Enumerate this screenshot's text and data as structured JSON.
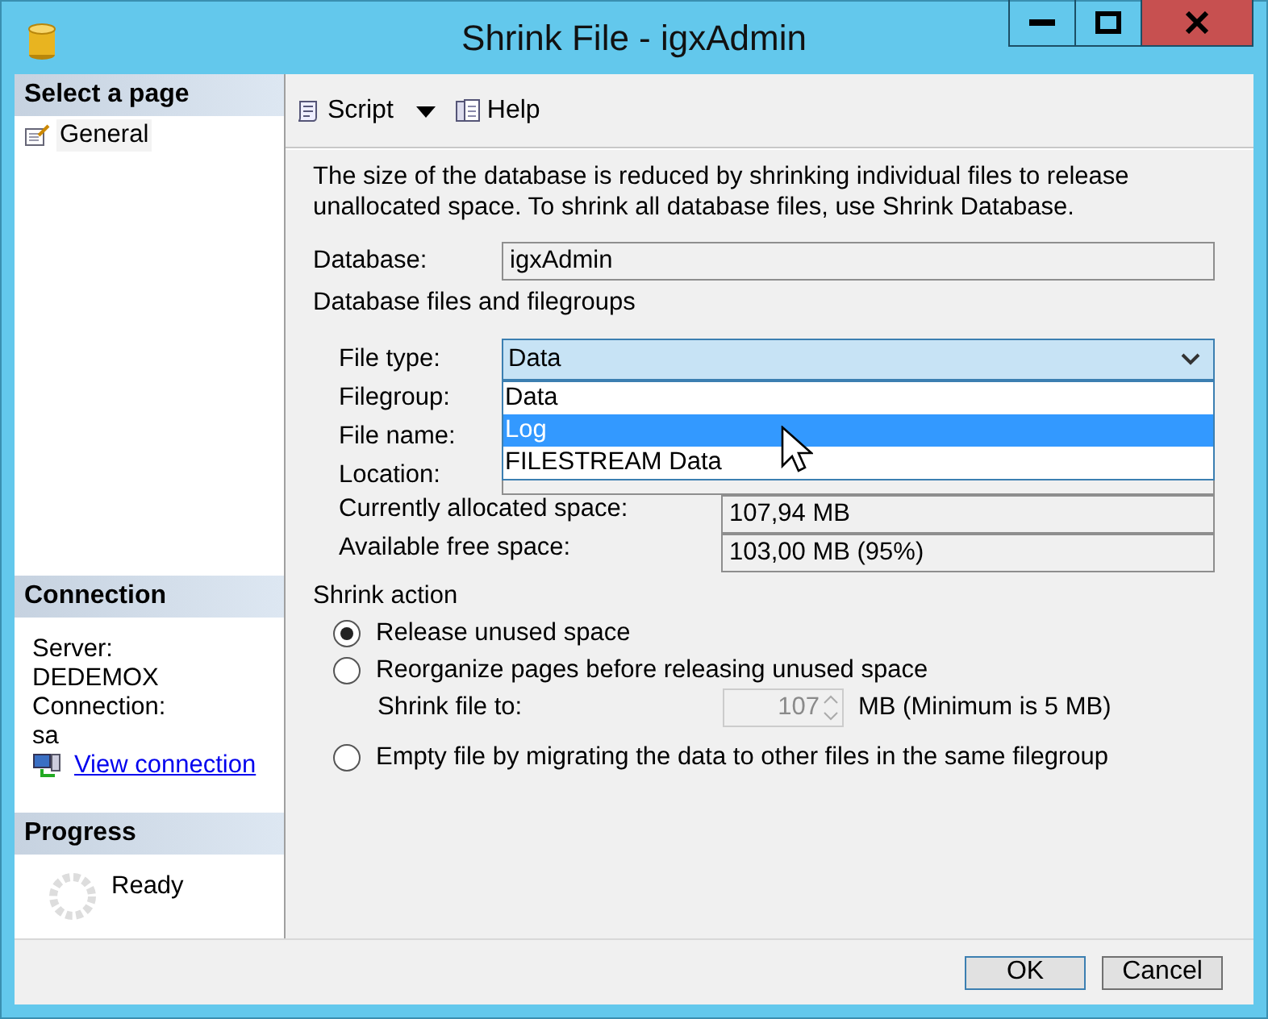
{
  "window": {
    "title": "Shrink File - igxAdmin"
  },
  "sidebar": {
    "select_page": {
      "heading": "Select a page",
      "items": [
        {
          "label": "General",
          "selected": true
        }
      ]
    },
    "connection": {
      "heading": "Connection",
      "server_label": "Server:",
      "server": "DEDEMOX",
      "connection_label": "Connection:",
      "connection": "sa",
      "link": "View connection"
    },
    "progress": {
      "heading": "Progress",
      "status": "Ready"
    }
  },
  "toolbar": [
    {
      "kind": "script",
      "label": "Script",
      "has_menu": true
    },
    {
      "kind": "help",
      "label": "Help",
      "has_menu": false
    }
  ],
  "description": "The size of the database is reduced by shrinking individual files to release unallocated space. To shrink all database files, use Shrink Database.",
  "database": {
    "label": "Database:",
    "value": "igxAdmin"
  },
  "files_section": {
    "heading": "Database files and filegroups",
    "file_type": {
      "label": "File type:",
      "value": "Data",
      "expanded": true,
      "options": [
        {
          "label": "Data",
          "highlighted": false
        },
        {
          "label": "Log",
          "highlighted": true
        },
        {
          "label": "FILESTREAM Data",
          "highlighted": false
        }
      ]
    },
    "filegroup_label": "Filegroup:",
    "file_name_label": "File name:",
    "location_label": "Location:",
    "allocated": {
      "label": "Currently allocated space:",
      "value": "107,94 MB"
    },
    "free": {
      "label": "Available free space:",
      "value": "103,00 MB (95%)"
    }
  },
  "shrink_action": {
    "heading": "Shrink action",
    "options": [
      {
        "label": "Release unused space",
        "selected": true
      },
      {
        "label": "Reorganize pages before releasing unused space",
        "selected": false
      },
      {
        "label": "Empty file by migrating the data to other files in the same filegroup",
        "selected": false
      }
    ],
    "shrink_to": {
      "label": "Shrink file to:",
      "value": "107",
      "unit": "MB (Minimum is 5 MB)",
      "disabled": true
    }
  },
  "buttons": [
    {
      "label": "OK",
      "default": true
    },
    {
      "label": "Cancel",
      "default": false
    }
  ]
}
